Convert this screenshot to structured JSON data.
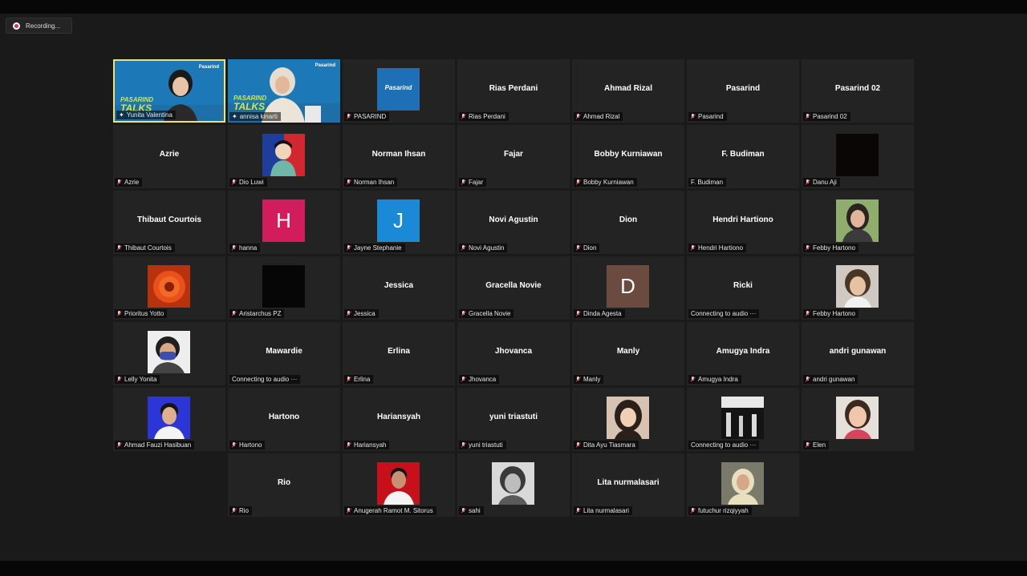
{
  "recording": {
    "label": "Recording..."
  },
  "colors": {
    "active_border": "#f2e45d",
    "tile_bg": "#232323",
    "muted": "#e0304a",
    "video_bg": "#1d78b8"
  },
  "video_tiles": [
    {
      "name": "Yunita Valentina",
      "brand": "Pasarind",
      "title_line1": "PASARIND",
      "title_line2": "TALKS",
      "active": true
    },
    {
      "name": "annisa kinarti",
      "brand": "Pasarind",
      "title_line1": "PASARIND",
      "title_line2": "TALKS"
    }
  ],
  "avatar_logo": {
    "text": "Pasarind"
  },
  "avatar_letters": {
    "hanna": "H",
    "jayne": "J",
    "dinda": "D"
  },
  "participants": {
    "pasarind_logo": "PASARIND",
    "rias": "Rias Perdani",
    "ahmad_rizal": "Ahmad Rizal",
    "pasarind": "Pasarind",
    "pasarind02": "Pasarind 02",
    "azrie": "Azrie",
    "dio": "Dio Luwi",
    "norman": "Norman Ihsan",
    "fajar": "Fajar",
    "bobby": "Bobby Kurniawan",
    "budiman": "F. Budiman",
    "danu": "Danu Aji",
    "thibaut": "Thibaut Courtois",
    "hanna": "hanna",
    "jayne": "Jayne Stephanie",
    "novi": "Novi Agustin",
    "dion": "Dion",
    "hendri": "Hendri Hartiono",
    "febby1": "Febby Hartono",
    "prioritus": "Prioritus Yotto",
    "aristarchus": "Aristarchus PZ",
    "jessica": "Jessica",
    "gracella": "Gracella Novie",
    "dinda": "Dinda Agesta",
    "ricki": "Ricki",
    "febby2": "Febby Hartono",
    "lelly": "Lelly Yonita",
    "mawardie": "Mawardie",
    "erlina": "Erlina",
    "jhovanca": "Jhovanca",
    "manly": "Manly",
    "amugya": "Amugya Indra",
    "andri": "andri gunawan",
    "fauzi": "Ahmad Fauzi Hasibuan",
    "hartono": "Hartono",
    "hariansyah": "Hariansyah",
    "yuni": "yuni triastuti",
    "dita": "Dita Ayu Tiasmara",
    "elen": "Elen",
    "rio": "Rio",
    "anugerah": "Anugerah Ramot M. Sitorus",
    "sahi": "sahi",
    "lita": "Lita nurmalasari",
    "futuchur": "futuchur rizqiyyah"
  },
  "status": {
    "connecting": "Connecting to audio ···"
  }
}
